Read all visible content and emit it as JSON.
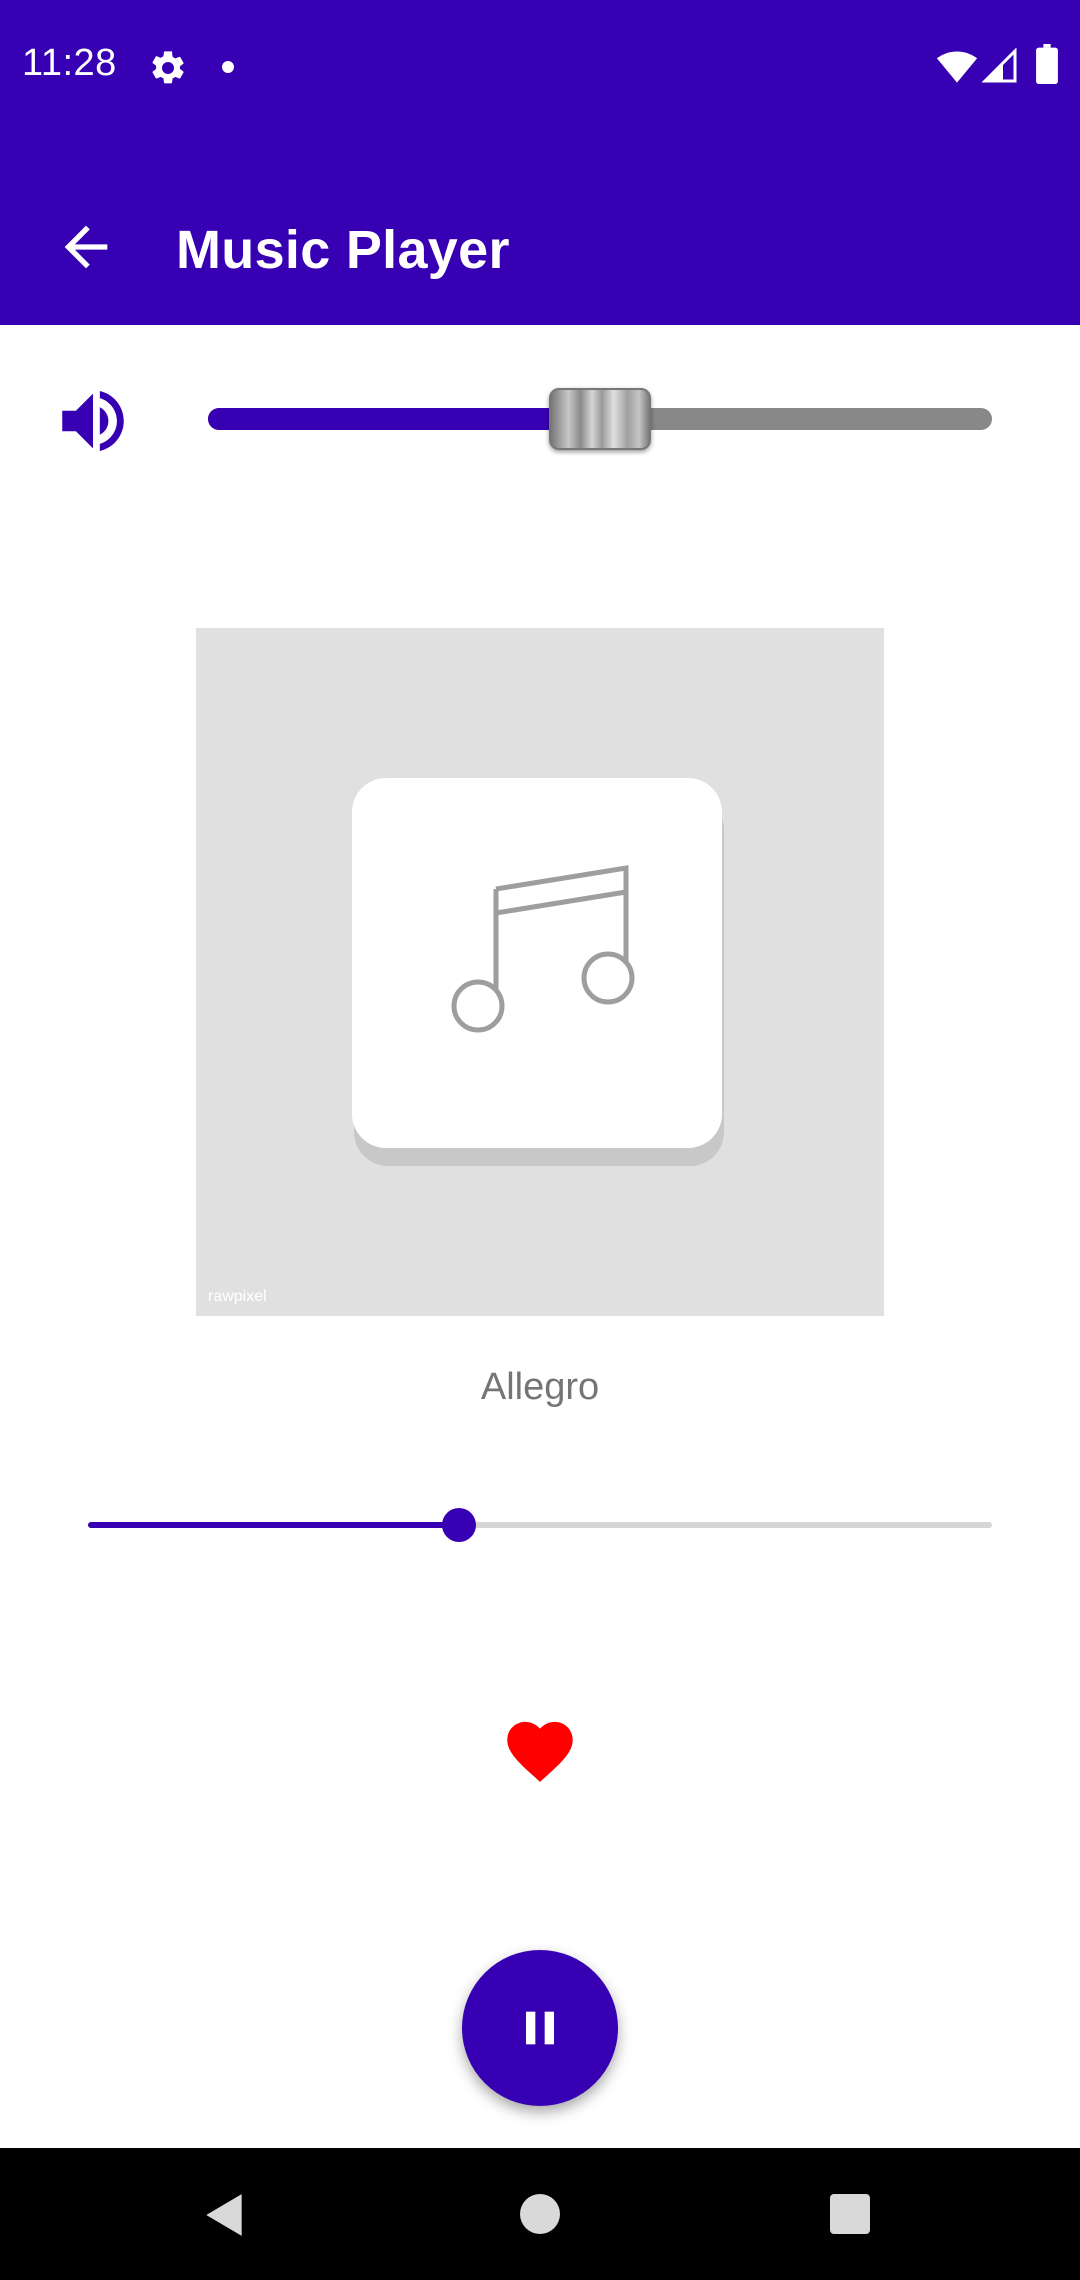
{
  "status_bar": {
    "time": "11:28",
    "icons": [
      "gear-icon",
      "notification-dot-icon",
      "wifi-icon",
      "cell-signal-icon",
      "battery-icon"
    ]
  },
  "app_bar": {
    "title": "Music Player",
    "back_icon": "arrow-back-icon"
  },
  "volume": {
    "icon": "volume-up-icon",
    "level_percent": 50
  },
  "album_art": {
    "icon": "music-note-icon",
    "watermark": "rawpixel"
  },
  "song": {
    "title": "Allegro"
  },
  "progress": {
    "percent": 41
  },
  "favorite": {
    "icon": "heart-icon",
    "active": true
  },
  "playback": {
    "icon": "pause-icon"
  },
  "nav_bar": {
    "icons": [
      "back-triangle-icon",
      "home-circle-icon",
      "recents-square-icon"
    ]
  },
  "colors": {
    "primary": "#3700b3",
    "favorite": "#ff0000",
    "text_secondary": "#757575",
    "volume_track": "#888888",
    "progress_track": "#d6d6d6",
    "album_background": "#e0e0e0"
  }
}
